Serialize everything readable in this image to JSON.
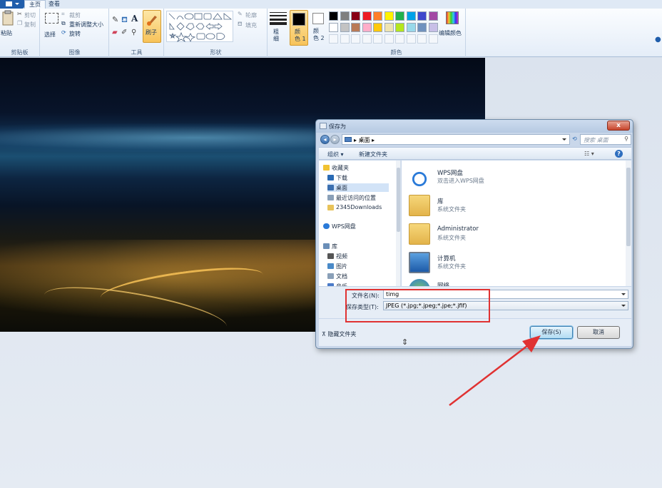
{
  "tabs": {
    "home": "主页",
    "view": "查看"
  },
  "ribbon": {
    "clipboard": {
      "paste": "粘贴",
      "cut": "剪切",
      "copy": "复制",
      "label": "剪贴板"
    },
    "image": {
      "select": "选择",
      "crop": "裁剪",
      "resize": "重新调整大小",
      "rotate": "旋转",
      "label": "图像"
    },
    "tools": {
      "brush": "刷子",
      "label": "工具"
    },
    "shapes": {
      "outline": "轮廓",
      "fill": "填充",
      "label": "形状"
    },
    "size": {
      "label": "粗\n细"
    },
    "color1": "颜\n色 1",
    "color2": "颜\n色 2",
    "colors": {
      "edit": "编辑颜色",
      "label": "颜色"
    },
    "palette_row1": [
      "#000000",
      "#7f7f7f",
      "#880015",
      "#ed1c24",
      "#ff7f27",
      "#fff200",
      "#22b14c",
      "#00a2e8",
      "#3f48cc",
      "#a349a4"
    ],
    "palette_row2": [
      "#ffffff",
      "#c3c3c3",
      "#b97a57",
      "#ffaec9",
      "#ffc90e",
      "#efe4b0",
      "#b5e61d",
      "#99d9ea",
      "#7092be",
      "#c8bfe7"
    ]
  },
  "dialog": {
    "title": "保存为",
    "close": "x",
    "address": "桌面",
    "address_sep": "▸",
    "search_placeholder": "搜索 桌面",
    "toolbar": {
      "organize": "组织",
      "new_folder": "新建文件夹"
    },
    "nav": [
      {
        "label": "收藏夹",
        "icon": "star-icon"
      },
      {
        "label": "下载",
        "icon": "download-icon"
      },
      {
        "label": "桌面",
        "icon": "desktop-icon",
        "selected": true
      },
      {
        "label": "最近访问的位置",
        "icon": "recent-icon"
      },
      {
        "label": "2345Downloads",
        "icon": "folder-icon"
      },
      {
        "label": "WPS网盘",
        "icon": "cloud-icon"
      },
      {
        "label": "库",
        "icon": "library-icon"
      },
      {
        "label": "视频",
        "icon": "video-icon"
      },
      {
        "label": "图片",
        "icon": "picture-icon"
      },
      {
        "label": "文档",
        "icon": "document-icon"
      },
      {
        "label": "音乐",
        "icon": "music-icon"
      }
    ],
    "files": [
      {
        "name": "WPS网盘",
        "desc": "双击进入WPS网盘",
        "icon": "cloud-icon"
      },
      {
        "name": "库",
        "desc": "系统文件夹",
        "icon": "library-folder-icon"
      },
      {
        "name": "Administrator",
        "desc": "系统文件夹",
        "icon": "user-folder-icon"
      },
      {
        "name": "计算机",
        "desc": "系统文件夹",
        "icon": "computer-icon"
      },
      {
        "name": "网络",
        "desc": "",
        "icon": "network-icon"
      }
    ],
    "filename_label": "文件名(N):",
    "filename_value": "timg",
    "filetype_label": "保存类型(T):",
    "filetype_value": "JPEG (*.jpg;*.jpeg;*.jpe;*.jfif)",
    "hide_folders": "隐藏文件夹",
    "save": "保存(S)",
    "cancel": "取消"
  },
  "colors": {
    "annotation_red": "#e03232",
    "ribbon_blue": "#1f5dab"
  }
}
